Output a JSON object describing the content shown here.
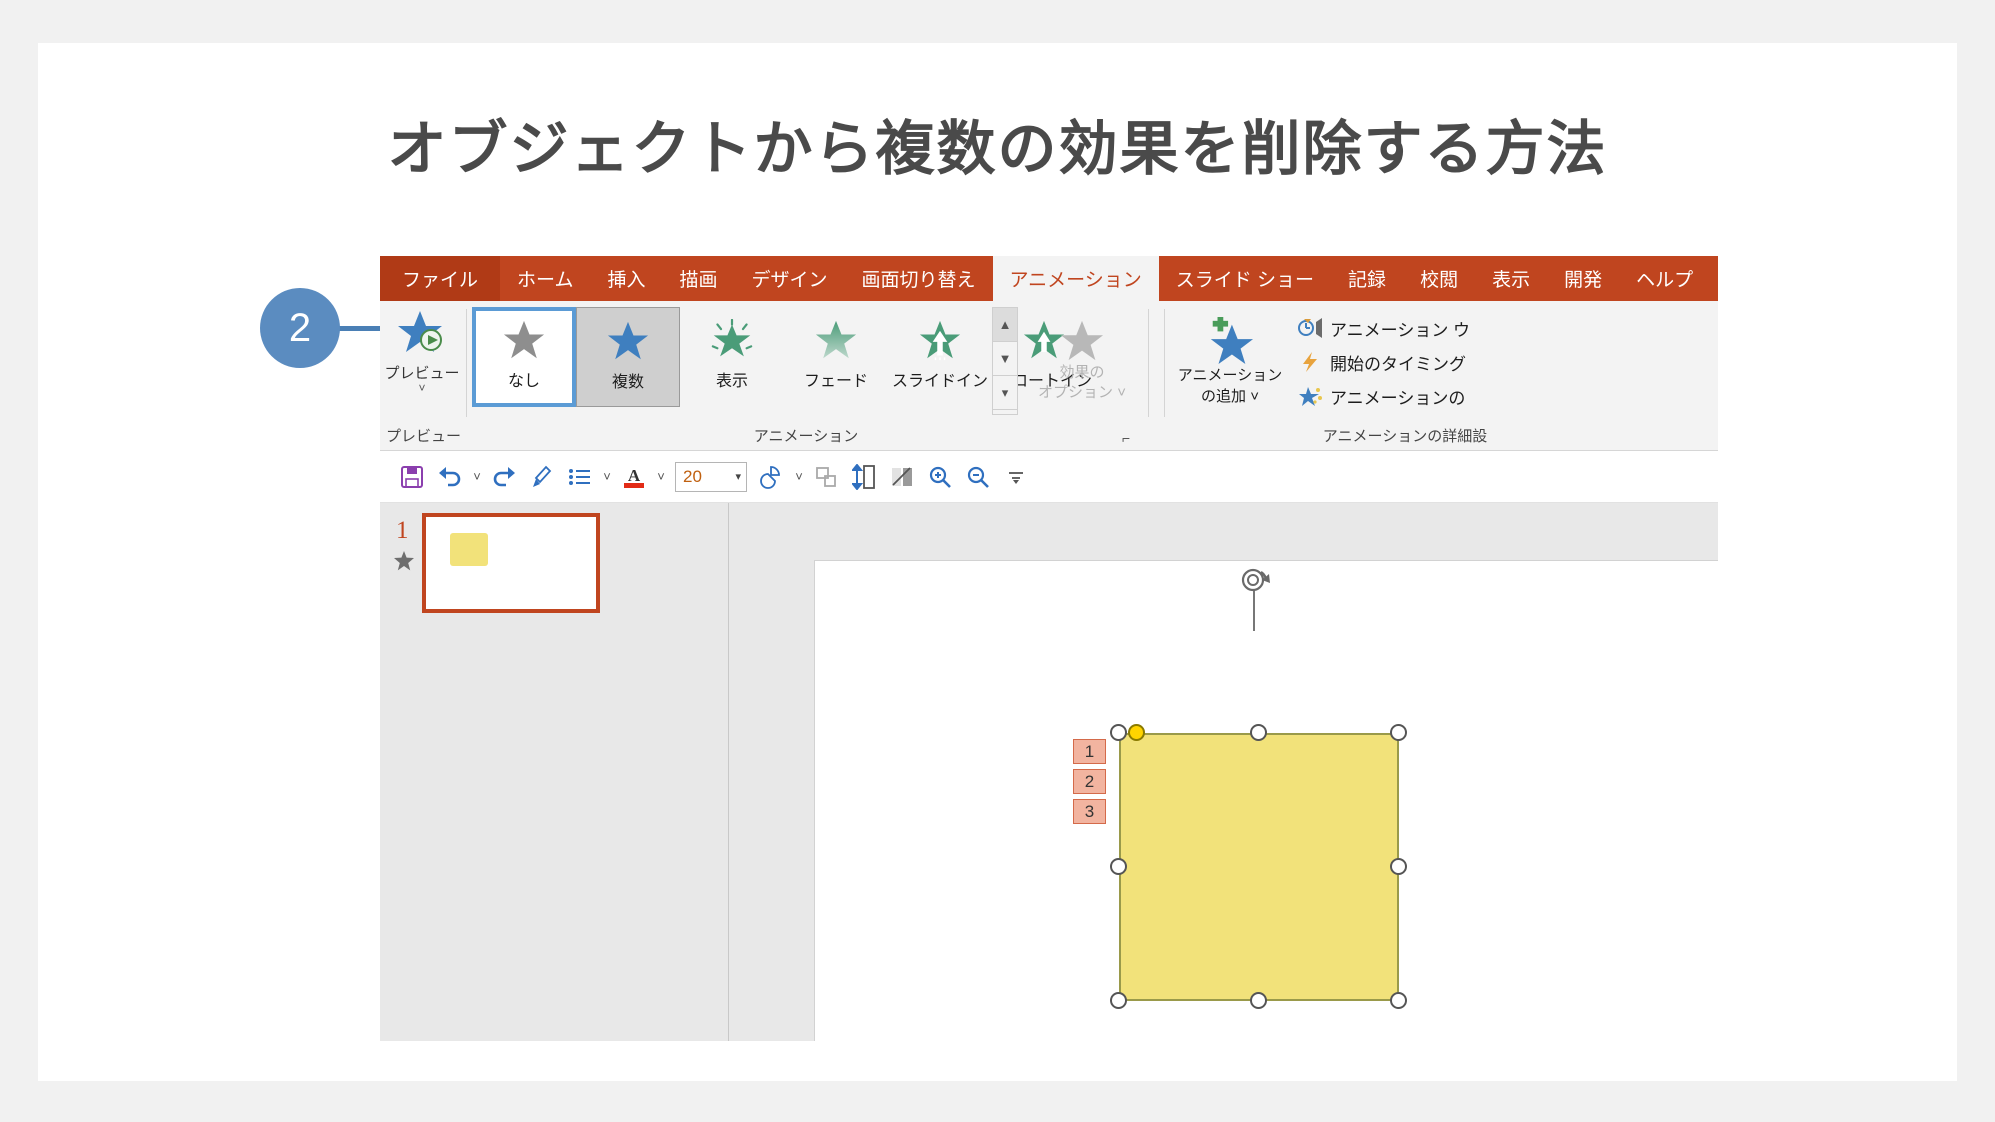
{
  "page": {
    "title": "オブジェクトから複数の効果を削除する方法",
    "background_color": "#f1f1f1",
    "card_color": "#ffffff",
    "title_color": "#4a4a4a"
  },
  "callout": {
    "number": "2",
    "circle_color": "#5b8cc0",
    "line_color": "#4a7fb5"
  },
  "ribbon": {
    "accent_color": "#c0451f",
    "tabs": [
      {
        "label": "ファイル",
        "state": "file"
      },
      {
        "label": "ホーム",
        "state": "normal"
      },
      {
        "label": "挿入",
        "state": "normal"
      },
      {
        "label": "描画",
        "state": "normal"
      },
      {
        "label": "デザイン",
        "state": "normal"
      },
      {
        "label": "画面切り替え",
        "state": "normal"
      },
      {
        "label": "アニメーション",
        "state": "active"
      },
      {
        "label": "スライド ショー",
        "state": "normal"
      },
      {
        "label": "記録",
        "state": "normal"
      },
      {
        "label": "校閲",
        "state": "normal"
      },
      {
        "label": "表示",
        "state": "normal"
      },
      {
        "label": "開発",
        "state": "normal"
      },
      {
        "label": "ヘルプ",
        "state": "normal"
      }
    ],
    "preview_button": {
      "label": "プレビュー",
      "icon": "star-play-icon",
      "dropdown": "˅"
    },
    "gallery": [
      {
        "label": "なし",
        "icon": "star-gray-icon",
        "state": "selected-outline"
      },
      {
        "label": "複数",
        "icon": "star-blue-icon",
        "state": "highlighted"
      },
      {
        "label": "表示",
        "icon": "star-burst-green-icon",
        "state": "normal"
      },
      {
        "label": "フェード",
        "icon": "star-fade-green-icon",
        "state": "normal"
      },
      {
        "label": "スライドイン",
        "icon": "star-slide-in-icon",
        "state": "normal"
      },
      {
        "label": "フロートイン",
        "icon": "star-float-in-icon",
        "state": "normal"
      }
    ],
    "effect_options": {
      "line1": "効果の",
      "line2": "オプション ˅",
      "icon": "star-gray-disabled-icon",
      "disabled": true
    },
    "add_animation": {
      "line1": "アニメーション",
      "line2": "の追加 ˅",
      "icon": "star-plus-icon"
    },
    "advanced_items": [
      {
        "label": "アニメーション ウ",
        "icon": "animation-pane-icon"
      },
      {
        "label": "開始のタイミング",
        "icon": "lightning-icon"
      },
      {
        "label": "アニメーションの",
        "icon": "animation-painter-icon"
      }
    ],
    "group_labels": [
      "プレビュー",
      "アニメーション",
      "アニメーションの詳細設"
    ],
    "dialog_launcher": "⌐"
  },
  "toolbar": {
    "items": [
      {
        "name": "save-icon",
        "caret": false
      },
      {
        "name": "undo-icon",
        "caret": true
      },
      {
        "name": "redo-icon",
        "caret": false
      },
      {
        "name": "format-painter-icon",
        "caret": false
      },
      {
        "name": "bullet-list-icon",
        "caret": true
      },
      {
        "name": "font-color-icon",
        "caret": true
      }
    ],
    "font_size": "20",
    "items_after": [
      {
        "name": "shapes-icon",
        "caret": true
      },
      {
        "name": "arrange-icon",
        "caret": false
      },
      {
        "name": "size-icon",
        "caret": false
      },
      {
        "name": "shape-format-icon",
        "caret": false
      },
      {
        "name": "zoom-in-icon",
        "caret": false
      },
      {
        "name": "zoom-out-icon",
        "caret": false
      },
      {
        "name": "more-icon",
        "caret": false
      }
    ]
  },
  "workspace": {
    "thumbnail": {
      "slide_number": "1",
      "animation_marker": "star-icon",
      "border_color": "#c0451f",
      "shape_color": "#f2e27a"
    },
    "canvas": {
      "shape_fill": "#f2e27a",
      "shape_border": "#9a9a4a",
      "animation_badges": [
        "1",
        "2",
        "3"
      ],
      "badge_fill": "#f2b4a0",
      "badge_border": "#d46a4a",
      "rotate_handle": "rotate-icon",
      "handles": 8
    }
  }
}
